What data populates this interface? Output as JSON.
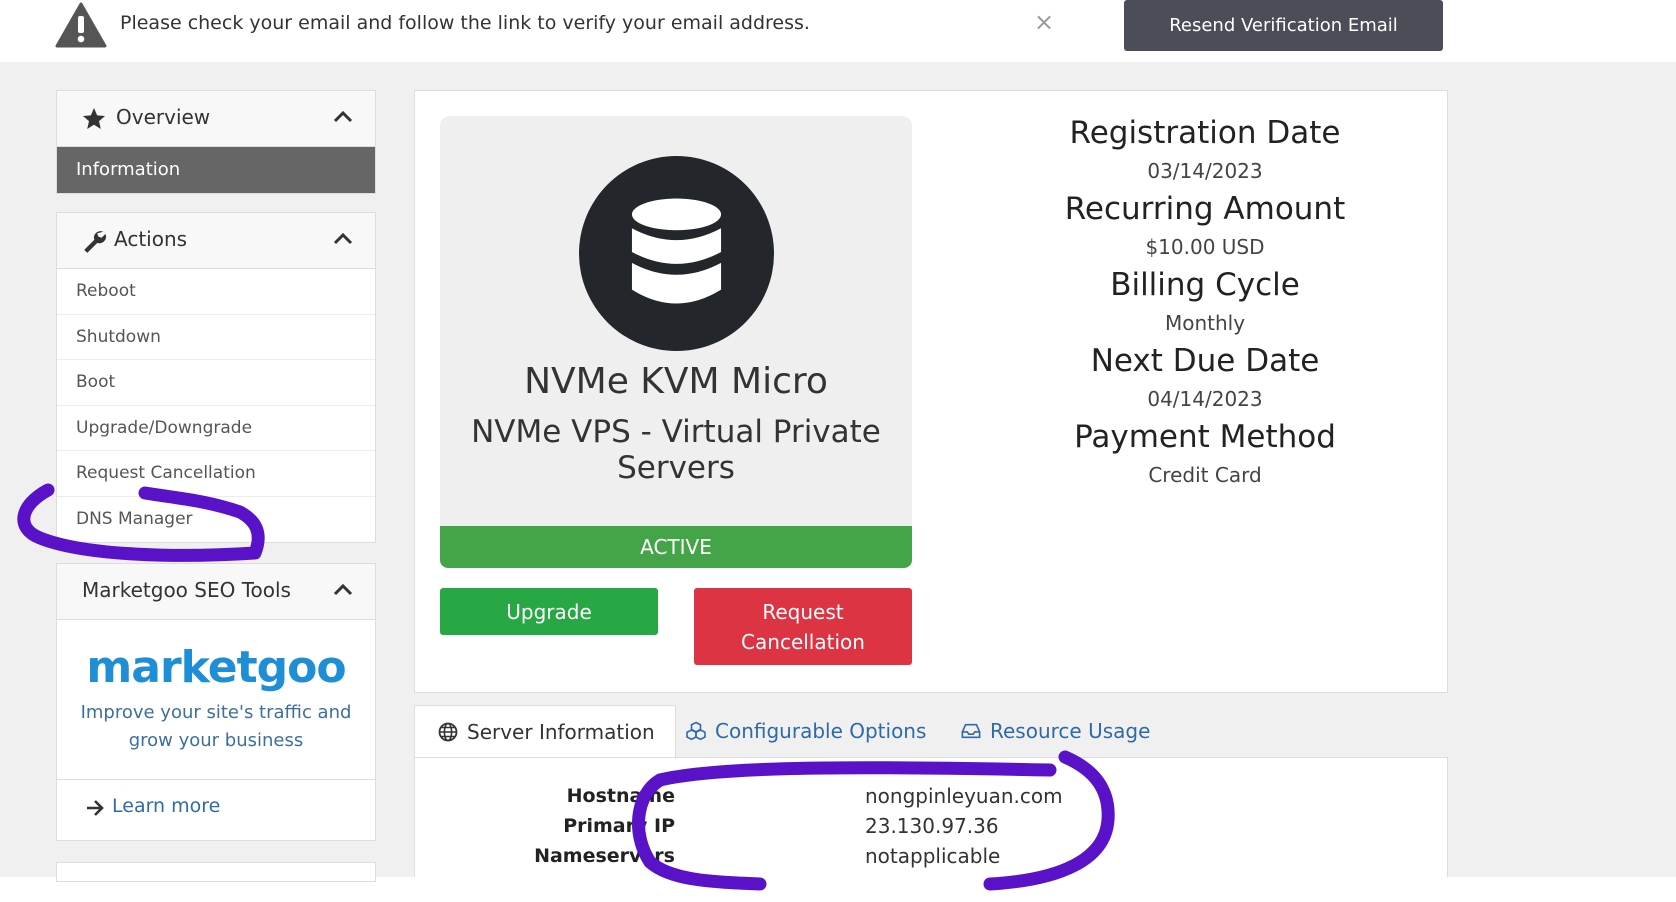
{
  "banner": {
    "message": "Please check your email and follow the link to verify your email address.",
    "close_glyph": "×",
    "resend_label": "Resend Verification Email"
  },
  "sidebar": {
    "overview": {
      "title": "Overview",
      "items": [
        {
          "label": "Information"
        }
      ]
    },
    "actions": {
      "title": "Actions",
      "items": [
        {
          "label": "Reboot"
        },
        {
          "label": "Shutdown"
        },
        {
          "label": "Boot"
        },
        {
          "label": "Upgrade/Downgrade"
        },
        {
          "label": "Request Cancellation"
        },
        {
          "label": "DNS Manager"
        }
      ]
    },
    "marketgoo": {
      "title": "Marketgoo SEO Tools",
      "logo_text": "marketgoo",
      "tagline": "Improve your site's traffic and grow your business",
      "learn_more": "Learn more"
    }
  },
  "product": {
    "name": "NVMe KVM Micro",
    "group": "NVMe VPS - Virtual Private Servers",
    "status": "ACTIVE",
    "upgrade_label": "Upgrade",
    "cancel_label": "Request Cancellation"
  },
  "billing": {
    "registration_date_label": "Registration Date",
    "registration_date": "03/14/2023",
    "recurring_amount_label": "Recurring Amount",
    "recurring_amount": "$10.00 USD",
    "billing_cycle_label": "Billing Cycle",
    "billing_cycle": "Monthly",
    "next_due_date_label": "Next Due Date",
    "next_due_date": "04/14/2023",
    "payment_method_label": "Payment Method",
    "payment_method": "Credit Card"
  },
  "tabs": [
    {
      "label": "Server Information",
      "icon": "globe-icon"
    },
    {
      "label": "Configurable Options",
      "icon": "cubes-icon"
    },
    {
      "label": "Resource Usage",
      "icon": "inbox-icon"
    }
  ],
  "server_info": {
    "hostname_label": "Hostname",
    "hostname": "nongpinleyuan.com",
    "primary_ip_label": "Primary IP",
    "primary_ip": "23.130.97.36",
    "nameservers_label": "Nameservers",
    "nameservers": "notapplicable"
  },
  "colors": {
    "status_active": "#43a547",
    "upgrade_button": "#27a844",
    "cancel_button": "#dd3444",
    "annotation_ink": "#5a12c9",
    "link": "#2f6aa8"
  }
}
